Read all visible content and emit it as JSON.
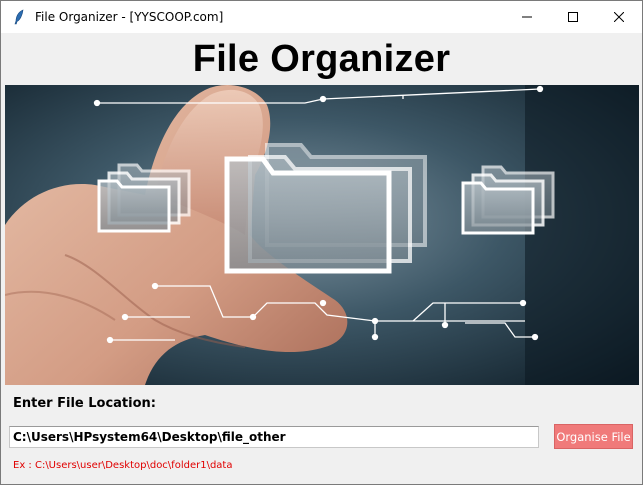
{
  "window": {
    "title": "File Organizer - [YYSCOOP.com]",
    "icons": {
      "app": "feather-icon",
      "minimize": "minimize-icon",
      "maximize": "maximize-icon",
      "close": "close-icon"
    }
  },
  "header": {
    "title": "File Organizer"
  },
  "banner": {
    "description": "hand-touching-folders-icon"
  },
  "form": {
    "location_label": "Enter File Location:",
    "path_value": "C:\\Users\\HPsystem64\\Desktop\\file_other",
    "button_label": "Organise File",
    "example_text": "Ex : C:\\Users\\user\\Desktop\\doc\\folder1\\data"
  },
  "colors": {
    "button_bg": "#f07a7a",
    "example_text": "#e00000",
    "background": "#f0f0f0"
  }
}
